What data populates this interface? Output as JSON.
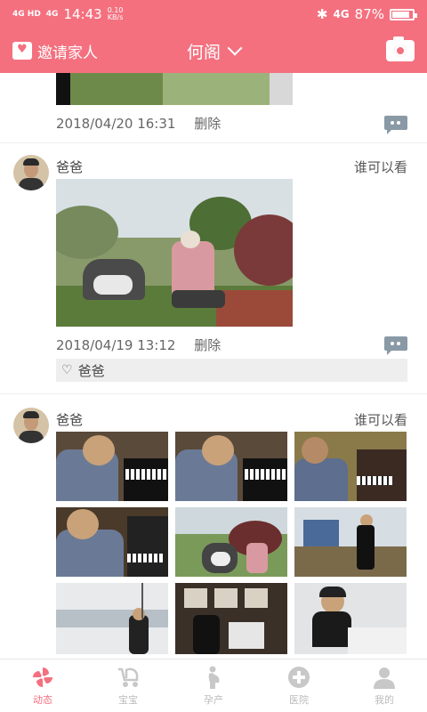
{
  "status": {
    "net1": "4G HD",
    "net2": "4G",
    "time": "14:43",
    "speed_value": "0.10",
    "speed_unit": "KB/s",
    "bt": "✱",
    "net3": "4G",
    "battery": "87%",
    "battery_level": 0.87
  },
  "header": {
    "invite_label": "邀请家人",
    "title": "何阁",
    "camera_icon": "camera-icon"
  },
  "posts": [
    {
      "timestamp": "2018/04/20 16:31",
      "delete_label": "删除"
    },
    {
      "author": "爸爸",
      "visibility_label": "谁可以看",
      "timestamp": "2018/04/19 13:12",
      "delete_label": "删除",
      "likes": "爸爸"
    },
    {
      "author": "爸爸",
      "visibility_label": "谁可以看"
    }
  ],
  "nav": {
    "items": [
      {
        "label": "动态",
        "icon": "pinwheel-icon",
        "active": true
      },
      {
        "label": "宝宝",
        "icon": "stroller-icon",
        "active": false
      },
      {
        "label": "孕产",
        "icon": "pregnant-icon",
        "active": false
      },
      {
        "label": "医院",
        "icon": "hospital-cross-icon",
        "active": false
      },
      {
        "label": "我的",
        "icon": "profile-icon",
        "active": false
      }
    ]
  },
  "colors": {
    "brand": "#f4707f",
    "muted": "#8a99a6"
  }
}
